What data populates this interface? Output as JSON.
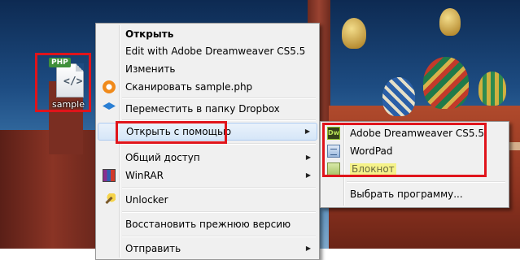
{
  "desktop": {
    "file": {
      "name": "sample",
      "badge": "PHP",
      "glyph": "</>"
    }
  },
  "context_menu": {
    "items": [
      {
        "label": "Открыть",
        "bold": true
      },
      {
        "label": "Edit with Adobe Dreamweaver CS5.5"
      },
      {
        "label": "Изменить"
      },
      {
        "label": "Сканировать sample.php",
        "icon": "avast-icon"
      },
      {
        "label": "Переместить в папку Dropbox",
        "icon": "dropbox-icon"
      },
      {
        "label": "Открыть с помощью",
        "submenu": true
      },
      {
        "label": "Общий доступ",
        "submenu": true
      },
      {
        "label": "WinRAR",
        "icon": "winrar-icon",
        "submenu": true
      },
      {
        "label": "Unlocker",
        "icon": "unlocker-icon"
      },
      {
        "label": "Восстановить прежнюю версию"
      },
      {
        "label": "Отправить",
        "submenu": true
      }
    ],
    "arrow": "▶"
  },
  "open_with_menu": {
    "items": [
      {
        "label": "Adobe Dreamweaver CS5.5",
        "icon": "dreamweaver-icon",
        "icon_text": "Dw"
      },
      {
        "label": "WordPad",
        "icon": "wordpad-icon"
      },
      {
        "label": "Блокнот",
        "icon": "notepad-icon"
      },
      {
        "label": "Выбрать программу..."
      }
    ]
  },
  "colors": {
    "annotation_red": "#e0141b",
    "highlight_yellow": "#f5f28a",
    "menu_bg": "#f0f0f0"
  }
}
